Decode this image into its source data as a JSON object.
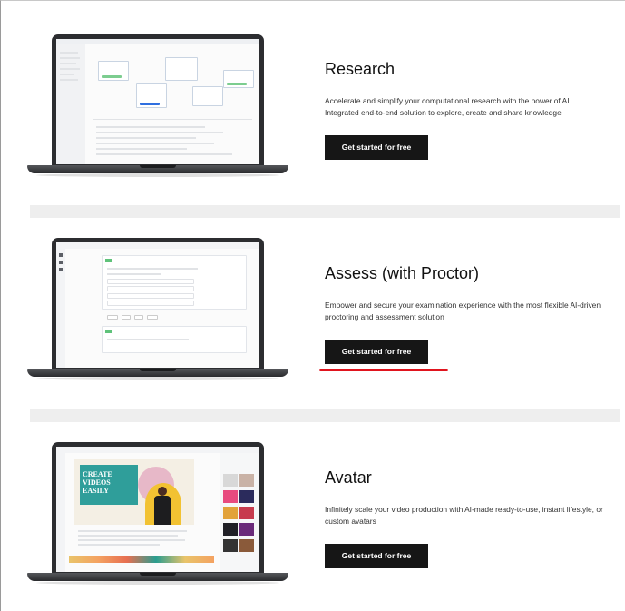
{
  "sections": [
    {
      "title": "Research",
      "description": "Accelerate and simplify your computational research with the power of AI. Integrated end-to-end solution to explore, create and share knowledge",
      "cta_label": "Get started for free"
    },
    {
      "title": "Assess (with Proctor)",
      "description": "Empower and secure your examination experience with the most flexible AI-driven proctoring and assessment solution",
      "cta_label": "Get started for free"
    },
    {
      "title": "Avatar",
      "description": "Infinitely scale your video production with AI-made ready-to-use, instant lifestyle, or custom avatars",
      "cta_label": "Get started for free"
    }
  ],
  "avatar_video": {
    "headline_line1": "CREATE",
    "headline_line2": "VIDEOS",
    "headline_line3": "EASILY"
  },
  "colors": {
    "cta_background": "#161616",
    "cta_text": "#ffffff",
    "highlight_underline": "#e0141e",
    "section_divider": "#eeeeee",
    "laptop_body": "#2c2d30"
  }
}
